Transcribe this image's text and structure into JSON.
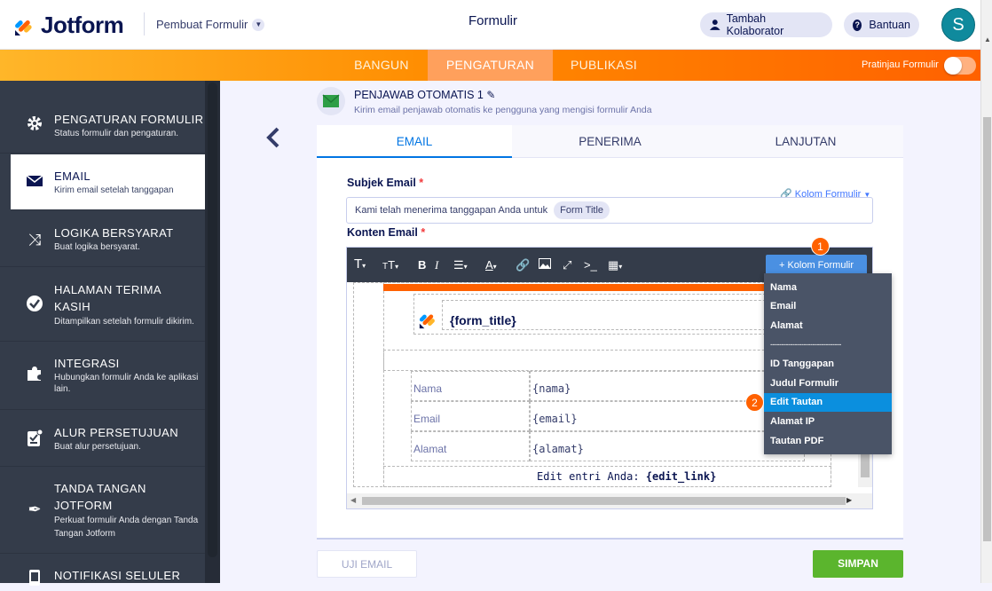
{
  "header": {
    "brand": "Jotform",
    "builder_label": "Pembuat Formulir",
    "form_title": "Formulir",
    "collab_label": "Tambah Kolaborator",
    "help_label": "Bantuan",
    "avatar_letter": "S"
  },
  "nav": {
    "tabs": [
      {
        "label": "BANGUN"
      },
      {
        "label": "PENGATURAN"
      },
      {
        "label": "PUBLIKASI"
      }
    ],
    "preview_label": "Pratinjau Formulir"
  },
  "sidebar": {
    "items": [
      {
        "title": "PENGATURAN FORMULIR",
        "sub": "Status formulir dan pengaturan.",
        "icon": "gear-icon"
      },
      {
        "title": "EMAIL",
        "sub": "Kirim email setelah tanggapan",
        "icon": "envelope-icon"
      },
      {
        "title": "LOGIKA BERSYARAT",
        "sub": "Buat logika bersyarat.",
        "icon": "shuffle-icon"
      },
      {
        "title": "HALAMAN TERIMA",
        "title2": "KASIH",
        "sub": "Ditampilkan setelah formulir dikirim.",
        "icon": "check-circle-icon"
      },
      {
        "title": "INTEGRASI",
        "sub": "Hubungkan formulir Anda ke aplikasi",
        "sub2": "lain.",
        "icon": "puzzle-icon"
      },
      {
        "title": "ALUR PERSETUJUAN",
        "sub": "Buat alur persetujuan.",
        "icon": "approval-icon"
      },
      {
        "title": "TANDA TANGAN",
        "title2": "JOTFORM",
        "sub": "Perkuat formulir Anda dengan Tanda",
        "sub2": "Tangan Jotform",
        "icon": "pen-icon"
      },
      {
        "title": "NOTIFIKASI SELULER",
        "icon": "mobile-icon"
      }
    ]
  },
  "autoresponder": {
    "title": "PENJAWAB OTOMATIS 1",
    "subtitle": "Kirim email penjawab otomatis ke pengguna yang mengisi formulir Anda"
  },
  "tabs": [
    {
      "label": "EMAIL"
    },
    {
      "label": "PENERIMA"
    },
    {
      "label": "LANJUTAN"
    }
  ],
  "subject": {
    "label": "Subjek Email",
    "required_mark": "*",
    "form_fields_link": "Kolom Formulir",
    "value": "Kami telah menerima tanggapan Anda untuk",
    "tag": "Form Title"
  },
  "content": {
    "label": "Konten Email",
    "required_mark": "*",
    "insert_button": "+ Kolom Formulir",
    "form_title_tag": "{form_title}",
    "rows": [
      {
        "label": "Nama",
        "value": "{nama}"
      },
      {
        "label": "Email",
        "value": "{email}"
      },
      {
        "label": "Alamat",
        "value": "{alamat}"
      }
    ],
    "edit_prefix": "Edit entri Anda:",
    "edit_link": "{edit_link}"
  },
  "dropdown": {
    "items": [
      "Nama",
      "Email",
      "Alamat",
      "--------------------------------",
      "ID Tanggapan",
      "Judul Formulir",
      "Edit Tautan",
      "Alamat IP",
      "Tautan PDF"
    ],
    "highlighted": "Edit Tautan"
  },
  "badges": [
    "1",
    "2"
  ],
  "footer": {
    "test_label": "UJI EMAIL",
    "save_label": "SIMPAN"
  },
  "colors": {
    "orange": "#ff6100",
    "save_green": "#5bb52d",
    "highlight_blue": "#0b8fde",
    "sidebar_dark": "#343c4a"
  }
}
